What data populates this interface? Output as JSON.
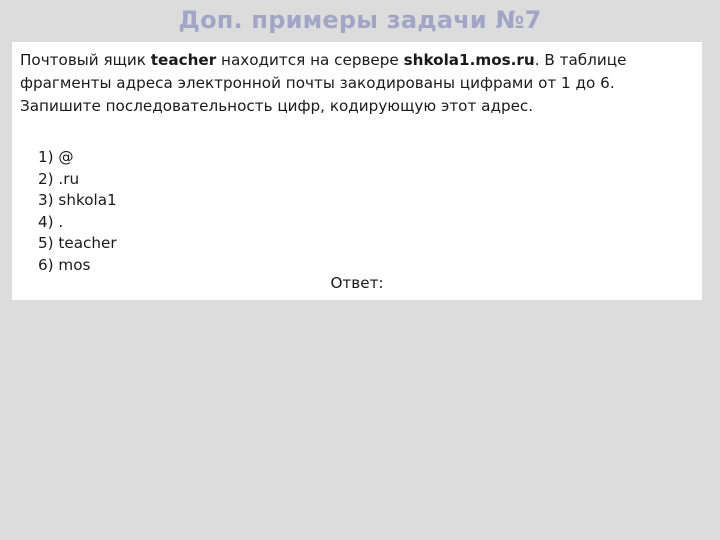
{
  "slide": {
    "title": "Доп. примеры задачи №7",
    "title_color": "#a2a6c6",
    "background_color": "#dcdcdc",
    "card_background_color": "#ffffff",
    "text_color": "#1a1a1a"
  },
  "problem": {
    "text_part1": "Почтовый ящик ",
    "bold1": "teacher",
    "text_part2": " находится на сервере ",
    "bold2": "shkola1.mos.ru",
    "text_part3": ". В таблице фрагменты адреса электронной почты закодированы цифрами от 1 до 6. Запишите последовательность цифр, кодирующую этот адрес."
  },
  "fragments": [
    {
      "number": "1)",
      "value": "@"
    },
    {
      "number": "2)",
      "value": ".ru"
    },
    {
      "number": "3)",
      "value": "shkola1"
    },
    {
      "number": "4)",
      "value": "."
    },
    {
      "number": "5)",
      "value": "teacher"
    },
    {
      "number": "6)",
      "value": "mos"
    }
  ],
  "answer": {
    "label": "Ответ:"
  }
}
